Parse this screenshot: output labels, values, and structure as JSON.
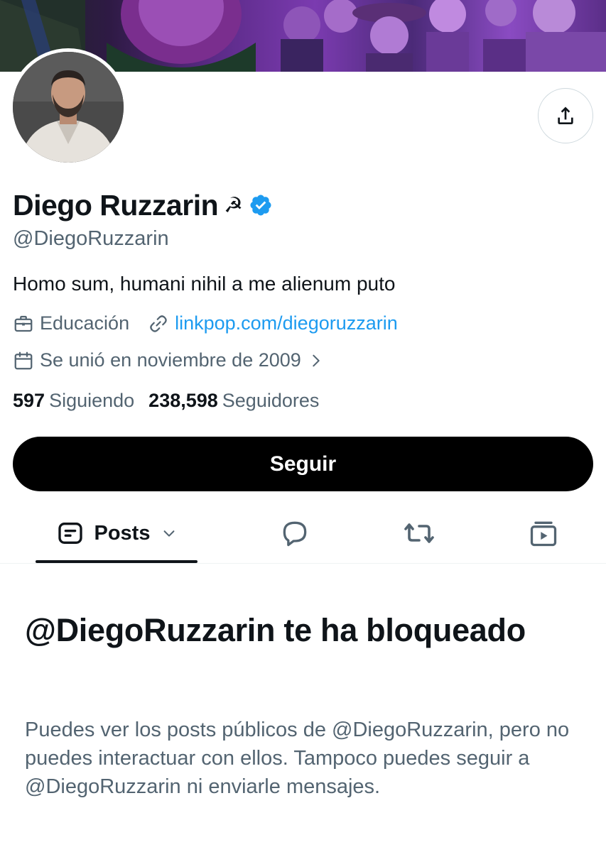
{
  "profile": {
    "display_name": "Diego Ruzzarin",
    "name_emoji": "☭",
    "verified": true,
    "handle": "@DiegoRuzzarin",
    "bio": "Homo sum, humani nihil a me alienum puto",
    "category": "Educación",
    "website": "linkpop.com/diegoruzzarin",
    "joined": "Se unió en noviembre de 2009",
    "following_count": "597",
    "following_label": "Siguiendo",
    "followers_count": "238,598",
    "followers_label": "Seguidores"
  },
  "actions": {
    "follow_label": "Seguir"
  },
  "tabs": [
    {
      "label": "Posts",
      "icon": "posts-icon",
      "selected": true
    },
    {
      "label": "",
      "icon": "reply-icon",
      "selected": false
    },
    {
      "label": "",
      "icon": "retweet-icon",
      "selected": false
    },
    {
      "label": "",
      "icon": "media-icon",
      "selected": false
    }
  ],
  "blocked": {
    "title": "@DiegoRuzzarin te ha bloqueado",
    "description": "Puedes ver los posts públicos de @DiegoRuzzarin, pero no puedes interactuar con ellos. Tampoco puedes seguir a @DiegoRuzzarin ni enviarle mensajes."
  },
  "colors": {
    "link": "#1d9bf0",
    "verified": "#1d9bf0",
    "secondary_text": "#536471",
    "primary_text": "#0f1419",
    "button_bg": "#000000"
  }
}
